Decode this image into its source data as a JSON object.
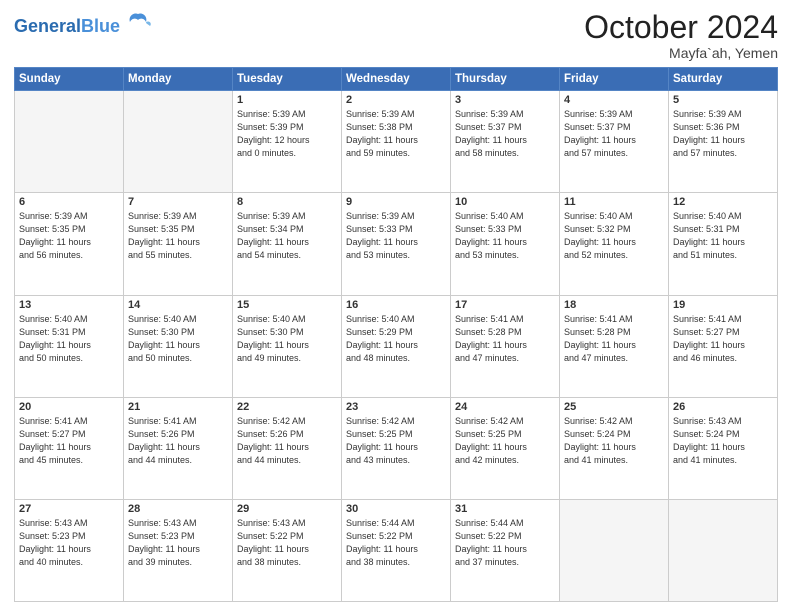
{
  "header": {
    "logo_general": "General",
    "logo_blue": "Blue",
    "month": "October 2024",
    "location": "Mayfa`ah, Yemen"
  },
  "weekdays": [
    "Sunday",
    "Monday",
    "Tuesday",
    "Wednesday",
    "Thursday",
    "Friday",
    "Saturday"
  ],
  "weeks": [
    [
      {
        "day": "",
        "info": ""
      },
      {
        "day": "",
        "info": ""
      },
      {
        "day": "1",
        "info": "Sunrise: 5:39 AM\nSunset: 5:39 PM\nDaylight: 12 hours\nand 0 minutes."
      },
      {
        "day": "2",
        "info": "Sunrise: 5:39 AM\nSunset: 5:38 PM\nDaylight: 11 hours\nand 59 minutes."
      },
      {
        "day": "3",
        "info": "Sunrise: 5:39 AM\nSunset: 5:37 PM\nDaylight: 11 hours\nand 58 minutes."
      },
      {
        "day": "4",
        "info": "Sunrise: 5:39 AM\nSunset: 5:37 PM\nDaylight: 11 hours\nand 57 minutes."
      },
      {
        "day": "5",
        "info": "Sunrise: 5:39 AM\nSunset: 5:36 PM\nDaylight: 11 hours\nand 57 minutes."
      }
    ],
    [
      {
        "day": "6",
        "info": "Sunrise: 5:39 AM\nSunset: 5:35 PM\nDaylight: 11 hours\nand 56 minutes."
      },
      {
        "day": "7",
        "info": "Sunrise: 5:39 AM\nSunset: 5:35 PM\nDaylight: 11 hours\nand 55 minutes."
      },
      {
        "day": "8",
        "info": "Sunrise: 5:39 AM\nSunset: 5:34 PM\nDaylight: 11 hours\nand 54 minutes."
      },
      {
        "day": "9",
        "info": "Sunrise: 5:39 AM\nSunset: 5:33 PM\nDaylight: 11 hours\nand 53 minutes."
      },
      {
        "day": "10",
        "info": "Sunrise: 5:40 AM\nSunset: 5:33 PM\nDaylight: 11 hours\nand 53 minutes."
      },
      {
        "day": "11",
        "info": "Sunrise: 5:40 AM\nSunset: 5:32 PM\nDaylight: 11 hours\nand 52 minutes."
      },
      {
        "day": "12",
        "info": "Sunrise: 5:40 AM\nSunset: 5:31 PM\nDaylight: 11 hours\nand 51 minutes."
      }
    ],
    [
      {
        "day": "13",
        "info": "Sunrise: 5:40 AM\nSunset: 5:31 PM\nDaylight: 11 hours\nand 50 minutes."
      },
      {
        "day": "14",
        "info": "Sunrise: 5:40 AM\nSunset: 5:30 PM\nDaylight: 11 hours\nand 50 minutes."
      },
      {
        "day": "15",
        "info": "Sunrise: 5:40 AM\nSunset: 5:30 PM\nDaylight: 11 hours\nand 49 minutes."
      },
      {
        "day": "16",
        "info": "Sunrise: 5:40 AM\nSunset: 5:29 PM\nDaylight: 11 hours\nand 48 minutes."
      },
      {
        "day": "17",
        "info": "Sunrise: 5:41 AM\nSunset: 5:28 PM\nDaylight: 11 hours\nand 47 minutes."
      },
      {
        "day": "18",
        "info": "Sunrise: 5:41 AM\nSunset: 5:28 PM\nDaylight: 11 hours\nand 47 minutes."
      },
      {
        "day": "19",
        "info": "Sunrise: 5:41 AM\nSunset: 5:27 PM\nDaylight: 11 hours\nand 46 minutes."
      }
    ],
    [
      {
        "day": "20",
        "info": "Sunrise: 5:41 AM\nSunset: 5:27 PM\nDaylight: 11 hours\nand 45 minutes."
      },
      {
        "day": "21",
        "info": "Sunrise: 5:41 AM\nSunset: 5:26 PM\nDaylight: 11 hours\nand 44 minutes."
      },
      {
        "day": "22",
        "info": "Sunrise: 5:42 AM\nSunset: 5:26 PM\nDaylight: 11 hours\nand 44 minutes."
      },
      {
        "day": "23",
        "info": "Sunrise: 5:42 AM\nSunset: 5:25 PM\nDaylight: 11 hours\nand 43 minutes."
      },
      {
        "day": "24",
        "info": "Sunrise: 5:42 AM\nSunset: 5:25 PM\nDaylight: 11 hours\nand 42 minutes."
      },
      {
        "day": "25",
        "info": "Sunrise: 5:42 AM\nSunset: 5:24 PM\nDaylight: 11 hours\nand 41 minutes."
      },
      {
        "day": "26",
        "info": "Sunrise: 5:43 AM\nSunset: 5:24 PM\nDaylight: 11 hours\nand 41 minutes."
      }
    ],
    [
      {
        "day": "27",
        "info": "Sunrise: 5:43 AM\nSunset: 5:23 PM\nDaylight: 11 hours\nand 40 minutes."
      },
      {
        "day": "28",
        "info": "Sunrise: 5:43 AM\nSunset: 5:23 PM\nDaylight: 11 hours\nand 39 minutes."
      },
      {
        "day": "29",
        "info": "Sunrise: 5:43 AM\nSunset: 5:22 PM\nDaylight: 11 hours\nand 38 minutes."
      },
      {
        "day": "30",
        "info": "Sunrise: 5:44 AM\nSunset: 5:22 PM\nDaylight: 11 hours\nand 38 minutes."
      },
      {
        "day": "31",
        "info": "Sunrise: 5:44 AM\nSunset: 5:22 PM\nDaylight: 11 hours\nand 37 minutes."
      },
      {
        "day": "",
        "info": ""
      },
      {
        "day": "",
        "info": ""
      }
    ]
  ]
}
